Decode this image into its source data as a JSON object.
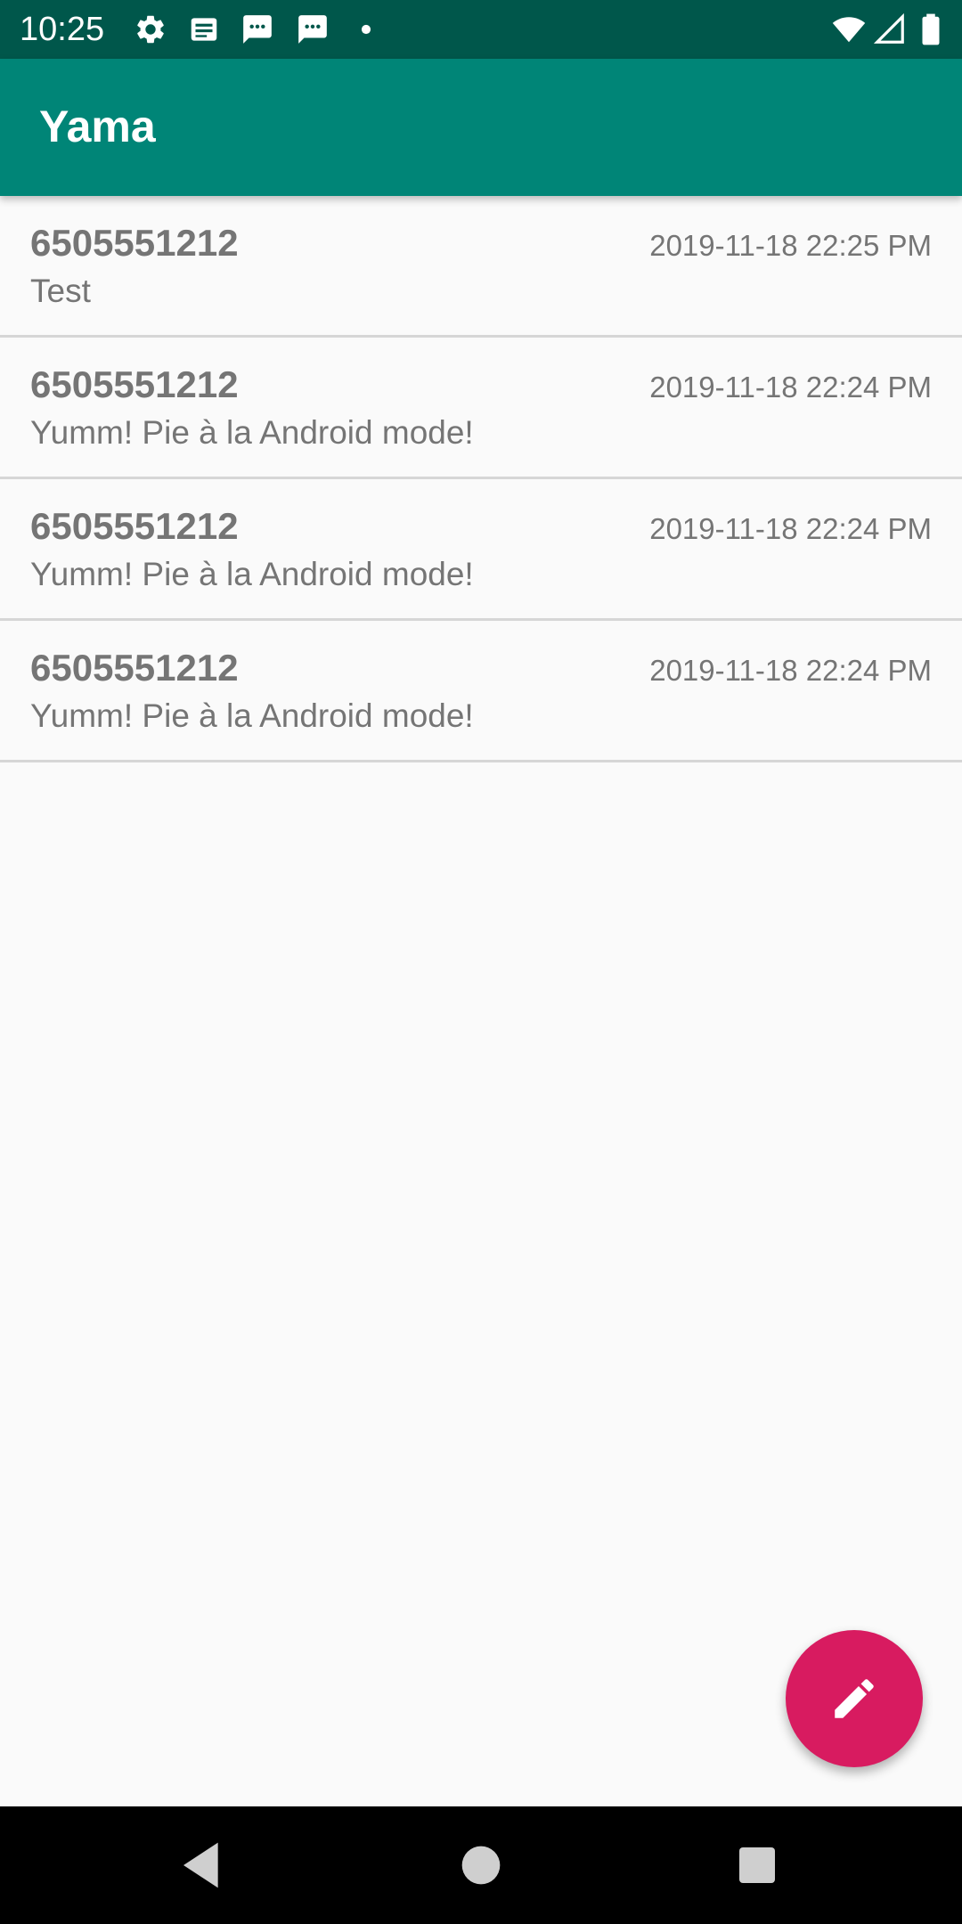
{
  "status_bar": {
    "time": "10:25",
    "left_icons": [
      "settings-icon",
      "news-icon",
      "message-icon",
      "message-icon",
      "dot-icon"
    ],
    "right_icons": [
      "wifi-icon",
      "signal-icon",
      "battery-icon"
    ]
  },
  "app_bar": {
    "title": "Yama",
    "color": "#008577",
    "status_color": "#00574b"
  },
  "messages": [
    {
      "sender": "6505551212",
      "time": "2019-11-18 22:25 PM",
      "body": "Test"
    },
    {
      "sender": "6505551212",
      "time": "2019-11-18 22:24 PM",
      "body": "Yumm! Pie à la Android mode!"
    },
    {
      "sender": "6505551212",
      "time": "2019-11-18 22:24 PM",
      "body": "Yumm! Pie à la Android mode!"
    },
    {
      "sender": "6505551212",
      "time": "2019-11-18 22:24 PM",
      "body": "Yumm! Pie à la Android mode!"
    }
  ],
  "fab": {
    "icon": "pencil-icon",
    "color": "#d81b60"
  },
  "nav_bar": {
    "buttons": [
      "back-icon",
      "home-icon",
      "recents-icon"
    ]
  }
}
